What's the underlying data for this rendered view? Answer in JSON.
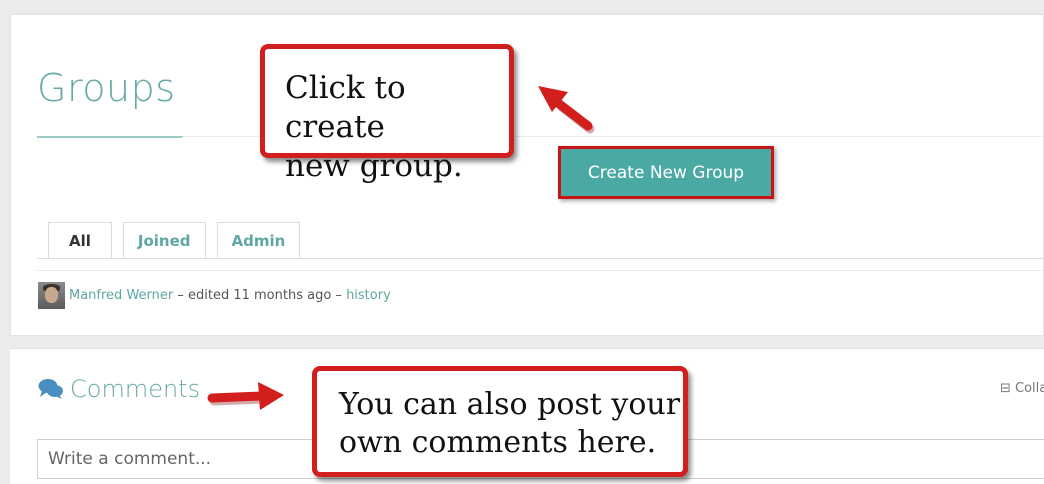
{
  "page": {
    "title": "Groups",
    "create_button_label": "Create New Group"
  },
  "tabs": [
    {
      "label": "All",
      "active": true
    },
    {
      "label": "Joined",
      "active": false
    },
    {
      "label": "Admin",
      "active": false
    }
  ],
  "edit_info": {
    "author": "Manfred Werner",
    "edited_text": " – edited 11 months ago – ",
    "history_link": "history"
  },
  "comments": {
    "heading": "Comments",
    "collapse_label": "⊟ Collapse",
    "input_placeholder": "Write a comment..."
  },
  "annotations": {
    "callout_create": [
      "Click to create",
      "new group."
    ],
    "callout_comments": [
      "You can also post your",
      "own comments here."
    ]
  },
  "colors": {
    "accent": "#4aa9a3",
    "title": "#68a9a7",
    "annotation_red": "#d31e1e"
  },
  "icons": [
    "comments-icon",
    "collapse-icon",
    "avatar",
    "arrow-icon"
  ]
}
